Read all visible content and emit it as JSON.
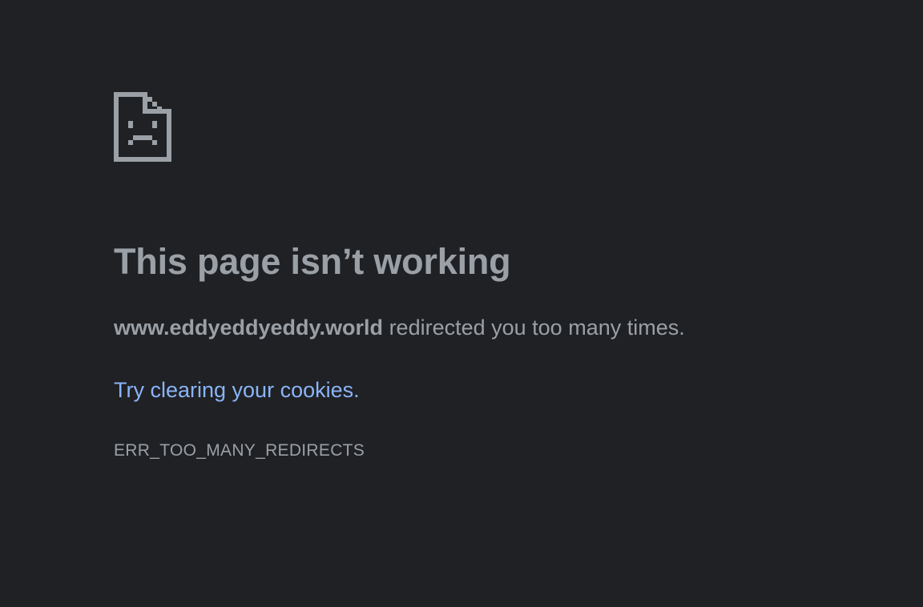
{
  "error": {
    "icon": "sad-page-icon",
    "title": "This page isn’t working",
    "host": "www.eddyeddyeddy.world",
    "message_rest": " redirected you too many times.",
    "suggestion_link": "Try clearing your cookies",
    "suggestion_end": ".",
    "code": "ERR_TOO_MANY_REDIRECTS"
  },
  "colors": {
    "background": "#202124",
    "text": "#9aa0a6",
    "link": "#8ab4f8"
  }
}
